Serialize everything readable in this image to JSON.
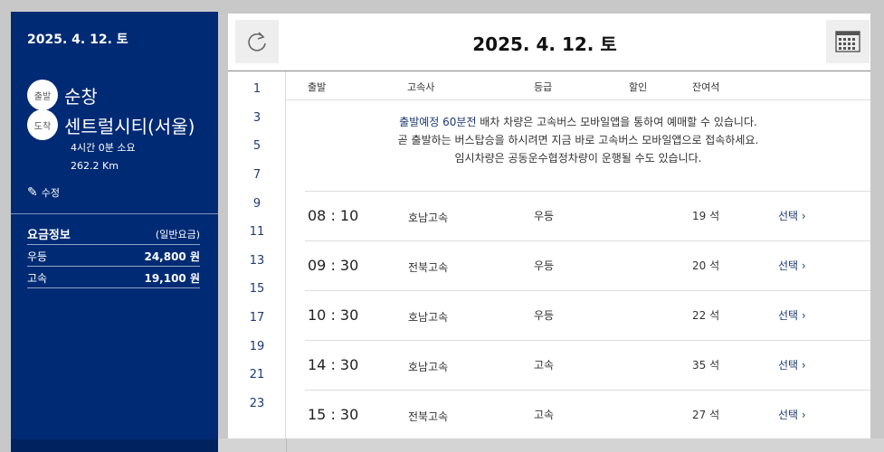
{
  "sidebar": {
    "date": "2025. 4. 12. 토",
    "departure": {
      "badge": "출발",
      "name": "순창"
    },
    "arrival": {
      "badge": "도착",
      "name": "센트럴시티(서울)"
    },
    "duration": "4시간 0분 소요",
    "distance": "262.2 Km",
    "edit_label": "수정",
    "fare": {
      "title": "요금정보",
      "subtitle": "(일반요금)",
      "rows": [
        {
          "grade": "우등",
          "amount": "24,800 원"
        },
        {
          "grade": "고속",
          "amount": "19,100 원"
        }
      ]
    }
  },
  "header": {
    "title": "2025. 4. 12. 토"
  },
  "hours": [
    "1",
    "3",
    "5",
    "7",
    "9",
    "11",
    "13",
    "15",
    "17",
    "19",
    "21",
    "23"
  ],
  "columns": {
    "departure": "출발",
    "company": "고속사",
    "grade": "등급",
    "discount": "할인",
    "seats": "잔여석"
  },
  "notice": {
    "highlight": "출발예정 60분전",
    "line1_rest": " 배차 차량은 고속버스 모바일앱을 통하여 예매할 수 있습니다.",
    "line2": "곧 출발하는 버스탑승을 하시려면 지금 바로 고속버스 모바일앱으로 접속하세요.",
    "line3": "임시차량은 공동운수협정차량이 운행될 수도 있습니다."
  },
  "schedule": [
    {
      "time": "08 : 10",
      "company": "호남고속",
      "grade": "우등",
      "seats": "19 석",
      "select": "선택"
    },
    {
      "time": "09 : 30",
      "company": "전북고속",
      "grade": "우등",
      "seats": "20 석",
      "select": "선택"
    },
    {
      "time": "10 : 30",
      "company": "호남고속",
      "grade": "우등",
      "seats": "22 석",
      "select": "선택"
    },
    {
      "time": "14 : 30",
      "company": "호남고속",
      "grade": "고속",
      "seats": "35 석",
      "select": "선택"
    },
    {
      "time": "15 : 30",
      "company": "전북고속",
      "grade": "고속",
      "seats": "27 석",
      "select": "선택"
    }
  ],
  "colors": {
    "navy": "#002a74",
    "link": "#1f3b73"
  }
}
